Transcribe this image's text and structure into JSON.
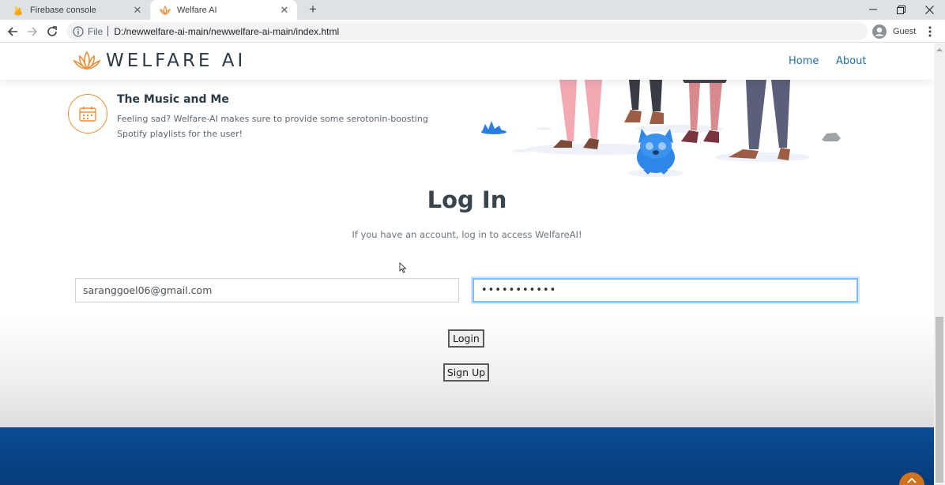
{
  "browser": {
    "tabs": [
      {
        "title": "Firebase console",
        "favicon": "firebase-flame-icon"
      },
      {
        "title": "Welfare AI",
        "favicon": "lotus-icon"
      }
    ],
    "address": {
      "scheme_label": "File",
      "url": "D:/newwelfare-ai-main/newwelfare-ai-main/index.html"
    },
    "profile": {
      "name": "Guest"
    }
  },
  "site": {
    "brand": "WELFARE AI",
    "nav": [
      {
        "label": "Home"
      },
      {
        "label": "About"
      }
    ],
    "accent_color": "#e8913b",
    "link_color": "#1f6ca8"
  },
  "feature": {
    "icon": "calendar-icon",
    "title": "The Music and Me",
    "description": "Feeling sad? Welfare-AI makes sure to provide some serotonin-boosting Spotify playlists for the user!"
  },
  "login": {
    "title": "Log In",
    "subtitle": "If you have an account, log in to access WelfareAI!",
    "email_value": "saranggoel06@gmail.com",
    "password_value": "•••••••••••",
    "login_label": "Login",
    "signup_label": "Sign Up"
  },
  "footer": {
    "color": "#0b4c94"
  }
}
